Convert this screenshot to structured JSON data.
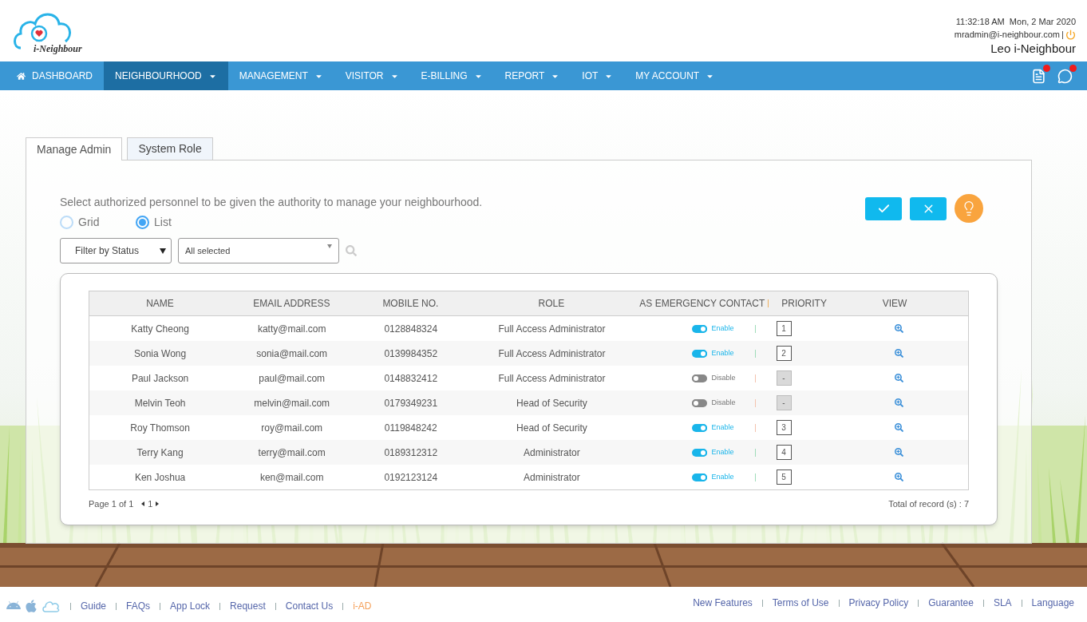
{
  "header": {
    "logo_text": "i-Neighbour",
    "datetime": "11:32:18 AM  Mon, 2 Mar 2020",
    "email": "mradmin@i-neighbour.com",
    "user": "Leo i-Neighbour"
  },
  "nav": [
    {
      "label": "DASHBOARD",
      "selected": false,
      "kind": "home"
    },
    {
      "label": "NEIGHBOURHOOD",
      "selected": true,
      "kind": "menu"
    },
    {
      "label": "MANAGEMENT",
      "selected": false,
      "kind": "menu"
    },
    {
      "label": "VISITOR",
      "selected": false,
      "kind": "menu"
    },
    {
      "label": "E-BILLING",
      "selected": false,
      "kind": "menu"
    },
    {
      "label": "REPORT",
      "selected": false,
      "kind": "menu"
    },
    {
      "label": "IOT",
      "selected": false,
      "kind": "menu"
    },
    {
      "label": "MY ACCOUNT",
      "selected": false,
      "kind": "menu"
    }
  ],
  "tabs": [
    {
      "label": "Manage Admin",
      "selected": true
    },
    {
      "label": "System Role",
      "selected": false
    }
  ],
  "instruction": "Select authorized personnel to be given the authority to manage your neighbourhood.",
  "view_options": [
    {
      "label": "Grid",
      "selected": false
    },
    {
      "label": "List",
      "selected": true
    }
  ],
  "filter": {
    "status": "Filter by Status",
    "selection": "All selected"
  },
  "table": {
    "columns": [
      "NAME",
      "EMAIL ADDRESS",
      "MOBILE NO.",
      "ROLE",
      "AS EMERGENCY CONTACT",
      "PRIORITY",
      "VIEW"
    ],
    "rows": [
      {
        "name": "Katty Cheong",
        "email": "katty@mail.com",
        "mobile": "0128848324",
        "role": "Full Access Administrator",
        "emergency": {
          "on": true,
          "label": "Enable",
          "color": "#9fdcb9"
        },
        "priority": "1"
      },
      {
        "name": "Sonia Wong",
        "email": "sonia@mail.com",
        "mobile": "0139984352",
        "role": "Full Access Administrator",
        "emergency": {
          "on": true,
          "label": "Enable",
          "color": "#9fdcb9"
        },
        "priority": "2"
      },
      {
        "name": "Paul Jackson",
        "email": "paul@mail.com",
        "mobile": "0148832412",
        "role": "Full Access Administrator",
        "emergency": {
          "on": false,
          "label": "Disable",
          "color": "#f4c2ad"
        },
        "priority": "-"
      },
      {
        "name": "Melvin Teoh",
        "email": "melvin@mail.com",
        "mobile": "0179349231",
        "role": "Head of Security",
        "emergency": {
          "on": false,
          "label": "Disable",
          "color": "#f4c2ad"
        },
        "priority": "-"
      },
      {
        "name": "Roy Thomson",
        "email": "roy@mail.com",
        "mobile": "0119848242",
        "role": "Head of Security",
        "emergency": {
          "on": true,
          "label": "Enable",
          "color": "#f4c2ad"
        },
        "priority": "3"
      },
      {
        "name": "Terry Kang",
        "email": "terry@mail.com",
        "mobile": "0189312312",
        "role": "Administrator",
        "emergency": {
          "on": true,
          "label": "Enable",
          "color": "#9fdcb9"
        },
        "priority": "4"
      },
      {
        "name": "Ken Joshua",
        "email": "ken@mail.com",
        "mobile": "0192123124",
        "role": "Administrator",
        "emergency": {
          "on": true,
          "label": "Enable",
          "color": "#9fdcb9"
        },
        "priority": "5"
      }
    ]
  },
  "pagination": {
    "page_info": "Page 1 of 1",
    "current": "1",
    "total": "Total of record (s) : 7"
  },
  "footer": {
    "left_links": [
      {
        "label": "Guide",
        "kind": "link"
      },
      {
        "label": "FAQs",
        "kind": "link"
      },
      {
        "label": "App Lock",
        "kind": "link"
      },
      {
        "label": "Request",
        "kind": "link"
      },
      {
        "label": "Contact Us",
        "kind": "link"
      },
      {
        "label": "i-AD",
        "kind": "ad"
      }
    ],
    "right_links": [
      "New Features",
      "Terms of Use",
      "Privacy Policy",
      "Guarantee",
      "SLA",
      "Language"
    ]
  }
}
